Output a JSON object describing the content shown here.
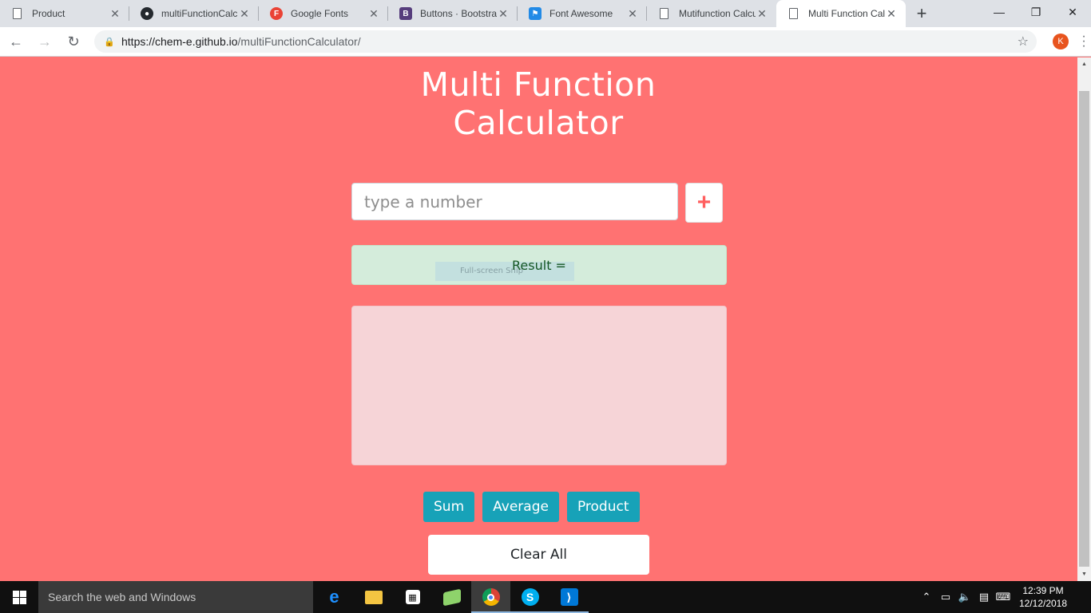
{
  "browser": {
    "tabs": [
      {
        "title": "Product",
        "favicon": "doc-icon",
        "active": false
      },
      {
        "title": "multiFunctionCalc",
        "favicon": "github-icon",
        "active": false
      },
      {
        "title": "Google Fonts",
        "favicon": "google-fonts-icon",
        "active": false
      },
      {
        "title": "Buttons · Bootstrap",
        "favicon": "bootstrap-icon",
        "active": false
      },
      {
        "title": "Font Awesome",
        "favicon": "font-awesome-icon",
        "active": false
      },
      {
        "title": "Mutifunction Calcu",
        "favicon": "doc-icon",
        "active": false
      },
      {
        "title": "Multi Function Cal",
        "favicon": "doc-icon",
        "active": true
      }
    ],
    "url_host": "https://chem-e.github.io",
    "url_path": "/multiFunctionCalculator/",
    "profile_initial": "K",
    "profile_color": "#e8541e"
  },
  "page": {
    "heading_line1": "Multi Function",
    "heading_line2": "Calculator",
    "input_placeholder": "type a number",
    "input_value": "",
    "add_label": "+",
    "result_label": "Result =",
    "fullscreen_hint": "Full-screen Snip",
    "operations": [
      "Sum",
      "Average",
      "Product"
    ],
    "clear_label": "Clear All",
    "colors": {
      "background": "#ff7272",
      "result_bg": "#d4ecdb",
      "list_bg": "#f6d4d7",
      "button": "#17a2b8",
      "plus": "#ff5f5f"
    }
  },
  "taskbar": {
    "search_placeholder": "Search the web and Windows",
    "time": "12:39 PM",
    "date": "12/12/2018",
    "apps": [
      "edge-icon",
      "file-explorer-icon",
      "store-icon",
      "photos-icon",
      "chrome-icon",
      "skype-icon",
      "vscode-icon"
    ]
  }
}
